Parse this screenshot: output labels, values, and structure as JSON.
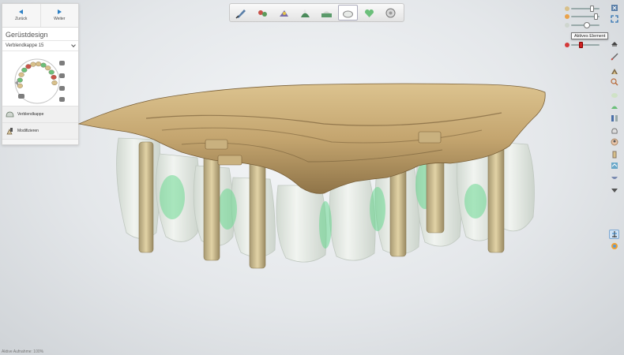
{
  "nav": {
    "back_label": "Zurück",
    "next_label": "Weiter"
  },
  "panel": {
    "title": "Gerüstdesign",
    "dropdown_value": "Verblendkappe 15",
    "tools": [
      {
        "label": "Verblendkappe",
        "icon": "cap-icon"
      },
      {
        "label": "Modifizieren",
        "icon": "modify-icon"
      }
    ]
  },
  "tooltip": {
    "text": "Aktives Element"
  },
  "status": {
    "text": "Aktive Aufnahme: 100%"
  },
  "workflow": {
    "steps": [
      {
        "name": "scan-brush-icon",
        "active": false
      },
      {
        "name": "articulator-icon",
        "active": false
      },
      {
        "name": "model-tool-icon",
        "active": false
      },
      {
        "name": "margin-line-icon",
        "active": false
      },
      {
        "name": "model-base-icon",
        "active": false
      },
      {
        "name": "framework-icon",
        "active": true
      },
      {
        "name": "tooth-heart-icon",
        "active": false
      },
      {
        "name": "finish-disc-icon",
        "active": false
      }
    ]
  },
  "right_toolbar": {
    "buttons": [
      "close-view-icon",
      "fit-view-icon",
      "cap-view-icon",
      "measure-icon",
      "scan-icon",
      "zoom-icon",
      "tooth-view-icon",
      "gingiva-icon",
      "section-icon",
      "crown-icon",
      "face-icon",
      "abutment-icon",
      "bite-icon",
      "jaw-icon",
      "distance-icon",
      "model-icon",
      "colormap-icon"
    ],
    "selected_index": 15
  },
  "colors": {
    "accent": "#2a7fc4",
    "framework": "#c9ad7a",
    "tooth": "#e6ece4",
    "contact_green": "#5fd78a"
  }
}
